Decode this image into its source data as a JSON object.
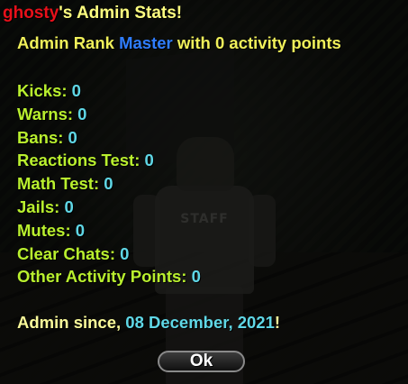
{
  "dialog": {
    "title": {
      "player_name": "ghosty",
      "suffix": "'s Admin Stats!"
    },
    "rank": {
      "prefix": "Admin Rank ",
      "value": "Master",
      "suffix": " with 0 activity points"
    },
    "stats": [
      {
        "label": "Kicks: ",
        "value": "0"
      },
      {
        "label": "Warns: ",
        "value": "0"
      },
      {
        "label": "Bans: ",
        "value": "0"
      },
      {
        "label": "Reactions Test: ",
        "value": "0"
      },
      {
        "label": "Math Test: ",
        "value": "0"
      },
      {
        "label": "Jails: ",
        "value": "0"
      },
      {
        "label": "Mutes: ",
        "value": "0"
      },
      {
        "label": "Clear Chats: ",
        "value": "0"
      },
      {
        "label": "Other Activity Points: ",
        "value": "0"
      }
    ],
    "since": {
      "prefix": "Admin since, ",
      "date": "08 December, 2021",
      "suffix": "!"
    },
    "ok_label": "Ok"
  },
  "background": {
    "shirt_print": "STAFF"
  },
  "colors": {
    "player_name": "#e8101a",
    "title_text": "#ffff80",
    "rank_text": "#f0f05a",
    "rank_value": "#2f7dff",
    "stat_label": "#b9f02e",
    "stat_value": "#5fd7e6",
    "since_text": "#fafa9a"
  }
}
